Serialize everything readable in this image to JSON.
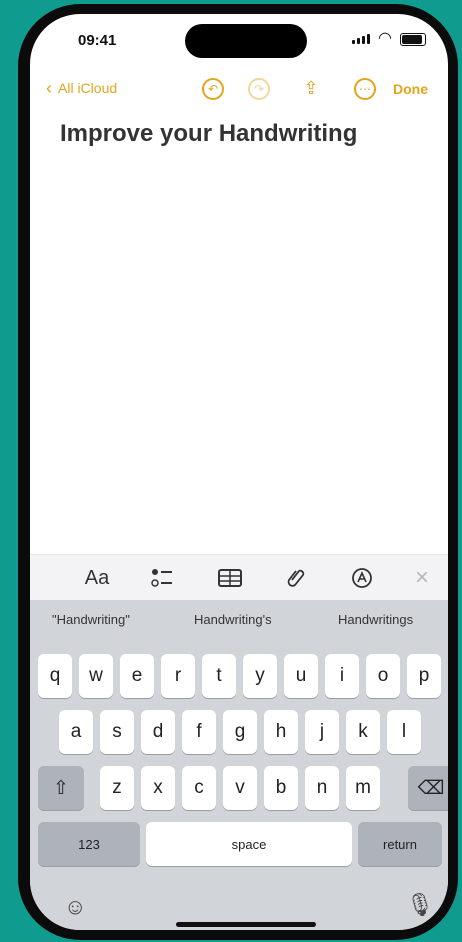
{
  "status": {
    "time": "09:41"
  },
  "toolbar": {
    "back_label": "All iCloud",
    "done_label": "Done"
  },
  "note": {
    "title": "Improve your Handwriting"
  },
  "format_bar": {
    "aa_label": "Aa"
  },
  "keyboard": {
    "predictions": [
      "\"Handwriting\"",
      "Handwriting's",
      "Handwritings"
    ],
    "row1": [
      "q",
      "w",
      "e",
      "r",
      "t",
      "y",
      "u",
      "i",
      "o",
      "p"
    ],
    "row2": [
      "a",
      "s",
      "d",
      "f",
      "g",
      "h",
      "j",
      "k",
      "l"
    ],
    "row3": [
      "z",
      "x",
      "c",
      "v",
      "b",
      "n",
      "m"
    ],
    "numbers_label": "123",
    "space_label": "space",
    "return_label": "return"
  },
  "colors": {
    "accent": "#e3a51c",
    "background": "#0f9c8e"
  }
}
